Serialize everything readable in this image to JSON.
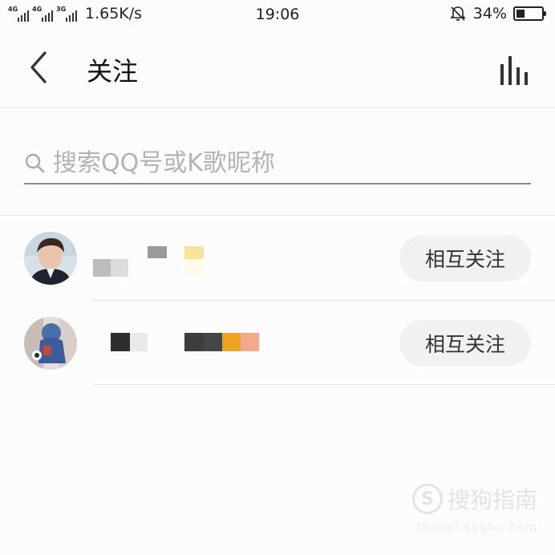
{
  "status_bar": {
    "network_1": "4G",
    "network_2": "4G",
    "network_3": "3G",
    "speed": "1.65K/s",
    "time": "19:06",
    "battery_percent": "34%",
    "battery_level": 0.34
  },
  "header": {
    "title": "关注",
    "back_icon": "chevron-left-icon",
    "chart_icon": "bar-chart-icon"
  },
  "search": {
    "placeholder": "搜索QQ号或K歌昵称",
    "value": ""
  },
  "follow_list": [
    {
      "follow_label": "相互关注"
    },
    {
      "follow_label": "相互关注"
    }
  ],
  "watermark": {
    "brand": "搜狗指南",
    "url": "zhinan.sogou.com"
  },
  "colors": {
    "background": "#fdfcfd",
    "divider": "#e6e6e6",
    "button_bg": "#f1f1f1",
    "placeholder": "#b3b3b3"
  }
}
